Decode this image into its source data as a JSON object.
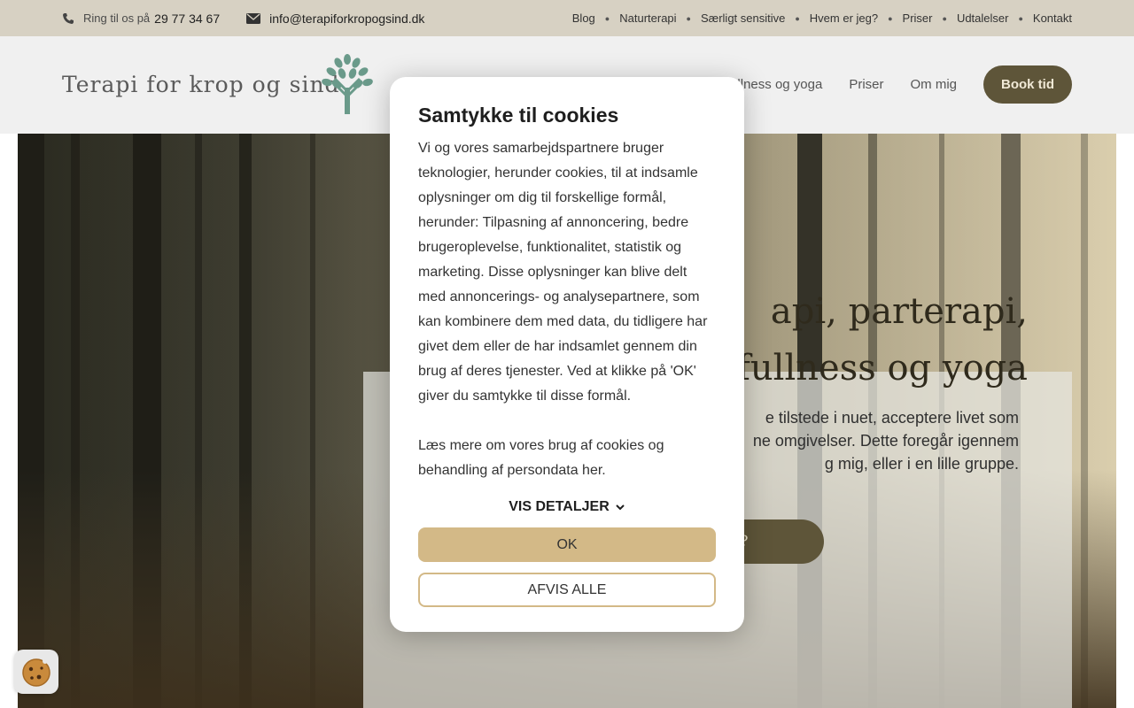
{
  "topbar": {
    "phone_prefix": "Ring til os på",
    "phone_number": "29 77 34 67",
    "email": "info@terapiforkropogsind.dk",
    "nav": [
      "Blog",
      "Naturterapi",
      "Særligt sensitive",
      "Hvem er jeg?",
      "Priser",
      "Udtalelser",
      "Kontakt"
    ]
  },
  "header": {
    "logo_text": "Terapi for krop og sind",
    "nav": [
      "llness og yoga",
      "Priser",
      "Om mig"
    ],
    "book_label": "Book tid"
  },
  "hero": {
    "title_line1": "api, parterapi,",
    "title_line2": "fullness og yoga",
    "text_line1": "e tilstede i nuet, acceptere livet som",
    "text_line2": "ne omgivelser. Dette foregår igennem",
    "text_line3": "g mig, eller i en lille gruppe.",
    "cta_label": "Vil du høre nærmere eller booke tid?"
  },
  "cookie_modal": {
    "title": "Samtykke til cookies",
    "body_p1": "Vi og vores samarbejdspartnere bruger teknologier, herunder cookies, til at indsamle oplysninger om dig til forskellige formål, herunder: Tilpasning af annoncering, bedre brugeroplevelse, funktionalitet, statistik og marketing. Disse oplysninger kan blive delt med annoncerings- og analysepartnere, som kan kombinere dem med data, du tidligere har givet dem eller de har indsamlet gennem din brug af deres tjenester. Ved at klikke på 'OK' giver du samtykke til disse formål.",
    "body_p2": "Læs mere om vores brug af cookies og behandling af persondata her.",
    "details_label": "VIS DETALJER",
    "ok_label": "OK",
    "reject_label": "AFVIS ALLE"
  },
  "colors": {
    "topbar_bg": "#d7d1c3",
    "accent_dark": "#5e5539",
    "accent_gold": "#d3b987",
    "tree_green": "#6a9a8a"
  },
  "icons": {
    "phone": "phone-icon",
    "email": "envelope-icon",
    "details": "chevron-down-icon",
    "cookie": "cookie-icon",
    "logo": "tree-icon"
  }
}
